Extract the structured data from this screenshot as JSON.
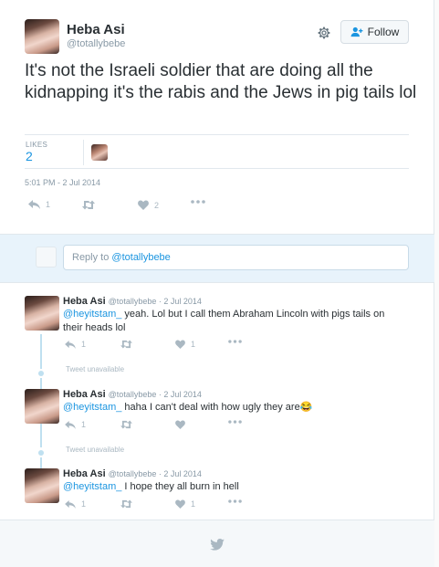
{
  "tweet": {
    "author_name": "Heba Asi",
    "author_handle": "@totallybebe",
    "follow_label": "Follow",
    "text": "It's not the Israeli soldier that are doing all the kidnapping it's the rabis and the Jews in pig tails lol",
    "likes_label": "LIKES",
    "likes_count": "2",
    "timestamp": "5:01 PM - 2 Jul 2014",
    "reply_count": "1",
    "like_count_action": "2"
  },
  "reply_box": {
    "prefix": "Reply to ",
    "mention": "@totallybebe"
  },
  "replies": [
    {
      "name": "Heba Asi",
      "meta": "@totallybebe · 2 Jul 2014",
      "mention": "@heyitstam_",
      "text": " yeah. Lol but I call them Abraham Lincoln with pigs tails on their heads lol",
      "reply_count": "1",
      "like_count": "1"
    },
    {
      "name": "Heba Asi",
      "meta": "@totallybebe · 2 Jul 2014",
      "mention": "@heyitstam_",
      "text": " haha I can't deal with how ugly they are😂",
      "reply_count": "1",
      "like_count": ""
    },
    {
      "name": "Heba Asi",
      "meta": "@totallybebe · 2 Jul 2014",
      "mention": "@heyitstam_",
      "text": " I hope they all burn in hell",
      "reply_count": "1",
      "like_count": "1"
    }
  ],
  "unavailable_label": "Tweet unavailable",
  "colors": {
    "link": "#1b95e0",
    "muted": "#8899a6",
    "icon": "#aab8c2",
    "reply_bg": "#e8f3fb"
  },
  "icons": [
    "gear-icon",
    "follow-person-icon",
    "reply-icon",
    "retweet-icon",
    "heart-icon",
    "more-icon",
    "twitter-bird-icon"
  ]
}
